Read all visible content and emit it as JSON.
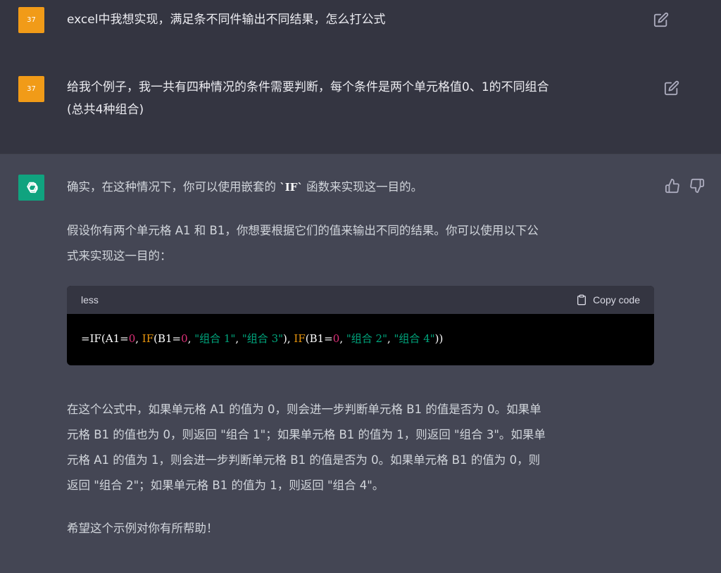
{
  "conversation": {
    "user_messages": [
      {
        "avatar_text": "37",
        "lines": [
          "excel中我想实现，满足条不同件输出不同结果，怎么打公式"
        ]
      },
      {
        "avatar_text": "37",
        "lines": [
          "给我个例子，我一共有四种情况的条件需要判断，每个条件是两个单元格值0、1的不同组合",
          "(总共4种组合)"
        ]
      }
    ],
    "assistant": {
      "intro_before": "确实，在这种情况下，你可以使用嵌套的 ",
      "intro_code": "`IF`",
      "intro_after": " 函数来实现这一目的。",
      "para2": [
        "假设你有两个单元格 A1 和 B1，你想要根据它们的值来输出不同的结果。你可以使用以下公",
        "式来实现这一目的："
      ],
      "code": {
        "language": "less",
        "copy_label": "Copy code",
        "tokens": [
          {
            "t": "=IF(A1=",
            "k": "plain"
          },
          {
            "t": "0",
            "k": "num"
          },
          {
            "t": ", ",
            "k": "plain"
          },
          {
            "t": "IF",
            "k": "fn"
          },
          {
            "t": "(B1=",
            "k": "plain"
          },
          {
            "t": "0",
            "k": "num"
          },
          {
            "t": ", ",
            "k": "plain"
          },
          {
            "t": "\"组合 1\"",
            "k": "str"
          },
          {
            "t": ", ",
            "k": "plain"
          },
          {
            "t": "\"组合 3\"",
            "k": "str"
          },
          {
            "t": "), ",
            "k": "plain"
          },
          {
            "t": "IF",
            "k": "fn"
          },
          {
            "t": "(B1=",
            "k": "plain"
          },
          {
            "t": "0",
            "k": "num"
          },
          {
            "t": ", ",
            "k": "plain"
          },
          {
            "t": "\"组合 2\"",
            "k": "str"
          },
          {
            "t": ", ",
            "k": "plain"
          },
          {
            "t": "\"组合 4\"",
            "k": "str"
          },
          {
            "t": "))",
            "k": "plain"
          }
        ]
      },
      "para3": [
        "在这个公式中，如果单元格 A1 的值为 0，则会进一步判断单元格 B1 的值是否为 0。如果单",
        "元格 B1 的值也为 0，则返回 \"组合 1\"；如果单元格 B1 的值为 1，则返回 \"组合 3\"。如果单",
        "元格 A1 的值为 1，则会进一步判断单元格 B1 的值是否为 0。如果单元格 B1 的值为 0，则",
        "返回 \"组合 2\"；如果单元格 B1 的值为 1，则返回 \"组合 4\"。"
      ],
      "closing": "希望这个示例对你有所帮助！"
    }
  },
  "icons": {
    "edit": "edit-icon",
    "copy": "clipboard-icon",
    "like": "thumbs-up-icon",
    "dislike": "thumbs-down-icon",
    "bot": "openai-logo-icon"
  },
  "colors": {
    "user_bg": "#343541",
    "assistant_bg": "#444654",
    "user_avatar": "#f19b18",
    "bot_avatar": "#10a37f",
    "code_number": "#df3079",
    "code_function": "#e9950c",
    "code_string": "#00a67d"
  }
}
